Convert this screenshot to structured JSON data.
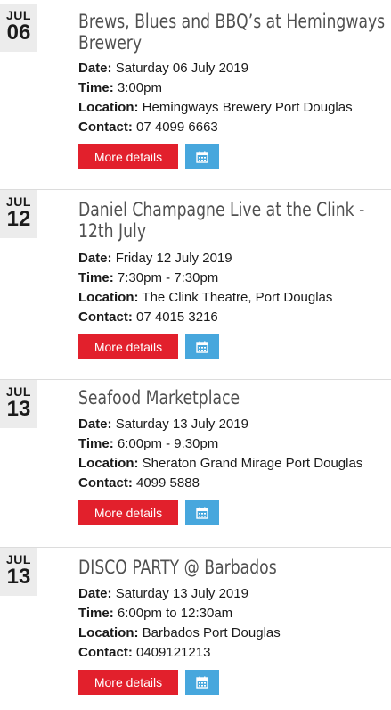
{
  "events": [
    {
      "month": "JUL",
      "day": "06",
      "title": "Brews, Blues and BBQ’s at Hemingways Brewery",
      "date_label": "Date:",
      "date": "Saturday 06 July 2019",
      "time_label": "Time:",
      "time": "3:00pm",
      "location_label": "Location:",
      "location": "Hemingways Brewery Port Douglas",
      "contact_label": "Contact:",
      "contact": "07 4099 6663",
      "details_label": "More details"
    },
    {
      "month": "JUL",
      "day": "12",
      "title": "Daniel Champagne Live at the Clink - 12th July",
      "date_label": "Date:",
      "date": "Friday 12 July 2019",
      "time_label": "Time:",
      "time": "7:30pm - 7:30pm",
      "location_label": "Location:",
      "location": "The Clink Theatre, Port Douglas",
      "contact_label": "Contact:",
      "contact": "07 4015 3216",
      "details_label": "More details"
    },
    {
      "month": "JUL",
      "day": "13",
      "title": "Seafood Marketplace",
      "date_label": "Date:",
      "date": "Saturday 13 July 2019",
      "time_label": "Time:",
      "time": "6:00pm - 9.30pm",
      "location_label": "Location:",
      "location": "Sheraton Grand Mirage Port Douglas",
      "contact_label": "Contact:",
      "contact": "4099 5888",
      "details_label": "More details"
    },
    {
      "month": "JUL",
      "day": "13",
      "title": "DISCO PARTY @ Barbados",
      "date_label": "Date:",
      "date": "Saturday 13 July 2019",
      "time_label": "Time:",
      "time": "6:00pm to 12:30am",
      "location_label": "Location:",
      "location": "Barbados Port Douglas",
      "contact_label": "Contact:",
      "contact": "0409121213",
      "details_label": "More details"
    }
  ],
  "colors": {
    "details_button": "#e2202c",
    "calendar_button": "#47a7dd",
    "date_box": "#ececec",
    "title_text": "#505050"
  },
  "icons": {
    "calendar_button": "calendar-icon"
  }
}
